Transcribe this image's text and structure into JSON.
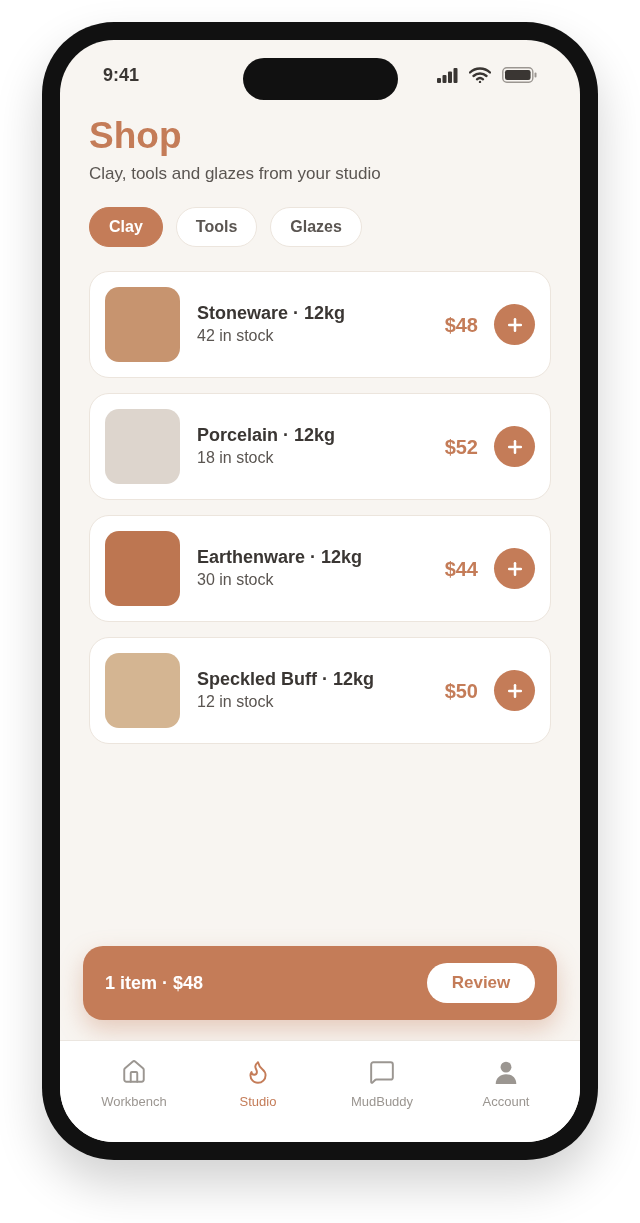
{
  "status_bar": {
    "time": "9:41"
  },
  "header": {
    "title": "Shop",
    "subtitle": "Clay, tools and glazes from your studio"
  },
  "filters": [
    {
      "label": "Clay",
      "selected": true
    },
    {
      "label": "Tools",
      "selected": false
    },
    {
      "label": "Glazes",
      "selected": false
    }
  ],
  "products": [
    {
      "name": "Stoneware · 12kg",
      "stock": "42 in stock",
      "price": "$48",
      "color": "#c7946f"
    },
    {
      "name": "Porcelain · 12kg",
      "stock": "18 in stock",
      "price": "$52",
      "color": "#ddd5cd"
    },
    {
      "name": "Earthenware · 12kg",
      "stock": "30 in stock",
      "price": "$44",
      "color": "#bd7651"
    },
    {
      "name": "Speckled Buff · 12kg",
      "stock": "12 in stock",
      "price": "$50",
      "color": "#d4b592"
    }
  ],
  "cart_bar": {
    "summary": "1 item · $48",
    "button": "Review"
  },
  "tab_bar": [
    {
      "label": "Workbench",
      "selected": false
    },
    {
      "label": "Studio",
      "selected": true
    },
    {
      "label": "MudBuddy",
      "selected": false
    },
    {
      "label": "Account",
      "selected": false
    }
  ]
}
